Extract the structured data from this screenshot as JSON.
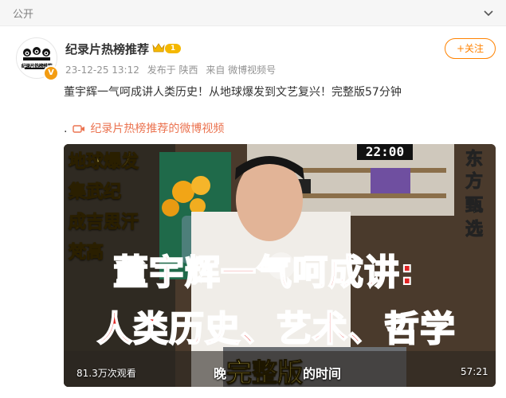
{
  "header": {
    "visibility_label": "公开",
    "collapse_icon": "chevron-down-icon"
  },
  "account": {
    "name": "纪录片热榜推荐",
    "avatar_text": "纪录片热榜推荐",
    "level": "1",
    "verified_badge": "V",
    "follow_label": "+关注"
  },
  "meta": {
    "time": "23-12-25 13:12",
    "location": "发布于 陕西",
    "source": "来自 微博视频号"
  },
  "post": {
    "text": "董宇辉一气呵成讲人类历史！从地球爆发到文艺复兴！完整版57分钟",
    "link_prefix": ".",
    "link_text": "纪录片热榜推荐的微博视频"
  },
  "video": {
    "left_overlays": [
      "地球爆发",
      "集武纪",
      "成吉思汗",
      "梵高"
    ],
    "right_overlays": [
      "东",
      "方",
      "甄",
      "选"
    ],
    "clock": "22:00",
    "title_line1": "董宇辉一气呵成讲:",
    "title_line2": "人类历史、艺术、哲学",
    "bottom_prefix": "晚",
    "bottom_big": "完整版",
    "bottom_suffix": "的时间",
    "views": "81.3万次观看",
    "duration": "57:21"
  },
  "colors": {
    "accent": "#ff8200",
    "link": "#eb7350",
    "title_red": "#e12424"
  }
}
